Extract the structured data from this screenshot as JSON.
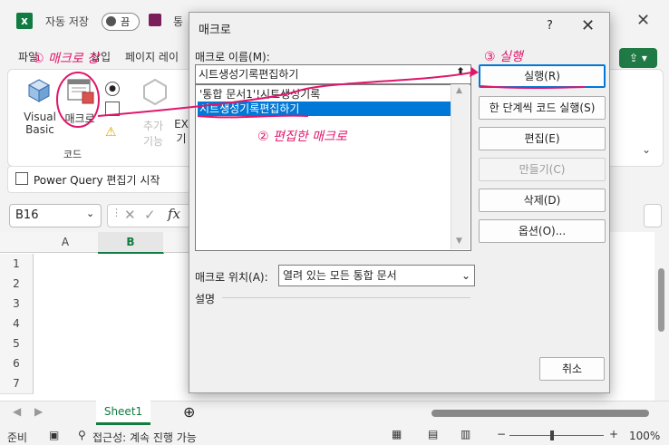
{
  "app": {
    "autosave_label": "자동 저장",
    "autosave_state": "끔",
    "title_tail": "통",
    "ribbon_tabs": [
      "파일",
      "삽입",
      "페이지 레이"
    ],
    "ribbon": {
      "visual_basic": "Visual Basic",
      "macros": "매크로",
      "group_code": "코드",
      "addins_partial": "추가 기능",
      "ex_partial": "EX 기",
      "power_query": "Power Query 편집기 시작"
    },
    "namebox": "B16",
    "columns": [
      "A",
      "B"
    ],
    "rows": [
      "1",
      "2",
      "3",
      "4",
      "5",
      "6",
      "7",
      "8"
    ],
    "sheet_tab": "Sheet1",
    "status_ready": "준비",
    "status_accessibility": "접근성: 계속 진행 가능",
    "zoom": "100%",
    "brand_color": "#107c41"
  },
  "dialog": {
    "title": "매크로",
    "help": "?",
    "name_label": "매크로 이름(M):",
    "name_value": "시트생성기록편집하기",
    "list_items": [
      "'통합 문서1'!시트생성기록",
      "시트생성기록편집하기"
    ],
    "selected_index": 1,
    "buttons": {
      "run": "실행(R)",
      "step": "한 단계씩 코드 실행(S)",
      "edit": "편집(E)",
      "create": "만들기(C)",
      "delete": "삭제(D)",
      "options": "옵션(O)..."
    },
    "location_label": "매크로 위치(A):",
    "location_value": "열려 있는 모든 통합 문서",
    "description_label": "설명",
    "cancel": "취소"
  },
  "annotations": {
    "step1": "① 매크로 창",
    "step2": "② 편집한 매크로",
    "step3": "③ 실행",
    "color": "#e0166b"
  }
}
